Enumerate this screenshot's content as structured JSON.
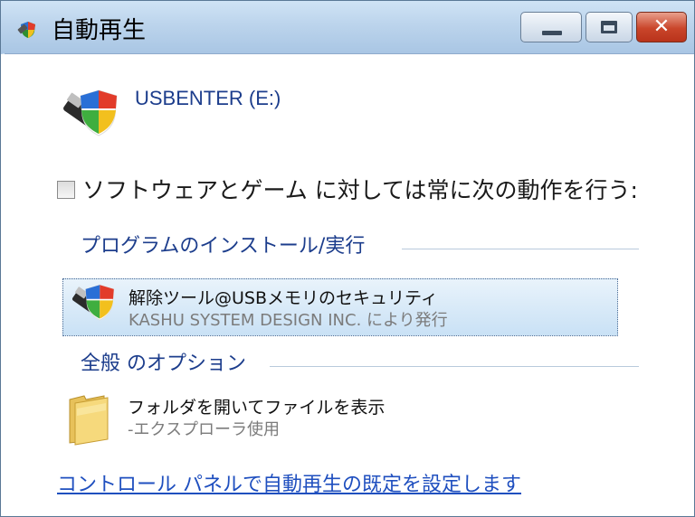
{
  "window": {
    "title": "自動再生",
    "icon": "autoplay-icon",
    "controls": {
      "minimize": "minimize-icon",
      "maximize": "maximize-icon",
      "close_glyph": "✕"
    }
  },
  "device": {
    "label": "USBENTER (E:)",
    "icon": "usb-drive-shield-icon"
  },
  "always_do": {
    "checked": false,
    "label": "ソフトウェアとゲーム に対しては常に次の動作を行う:"
  },
  "sections": [
    {
      "heading": "プログラムのインストール/実行",
      "options": [
        {
          "title": "解除ツール@USBメモリのセキュリティ",
          "subtitle": "KASHU SYSTEM DESIGN INC. により発行",
          "icon": "usb-drive-shield-icon",
          "selected": true
        }
      ]
    },
    {
      "heading": "全般 のオプション",
      "options": [
        {
          "title": "フォルダを開いてファイルを表示",
          "subtitle": "-エクスプローラ使用",
          "icon": "folder-icon",
          "selected": false
        }
      ]
    }
  ],
  "footer_link": "コントロール パネルで自動再生の既定を設定します",
  "colors": {
    "link": "#1f4fbf",
    "heading": "#1c3d8c",
    "selection_bg": "#c9e1f5",
    "close_button": "#c9452a"
  }
}
